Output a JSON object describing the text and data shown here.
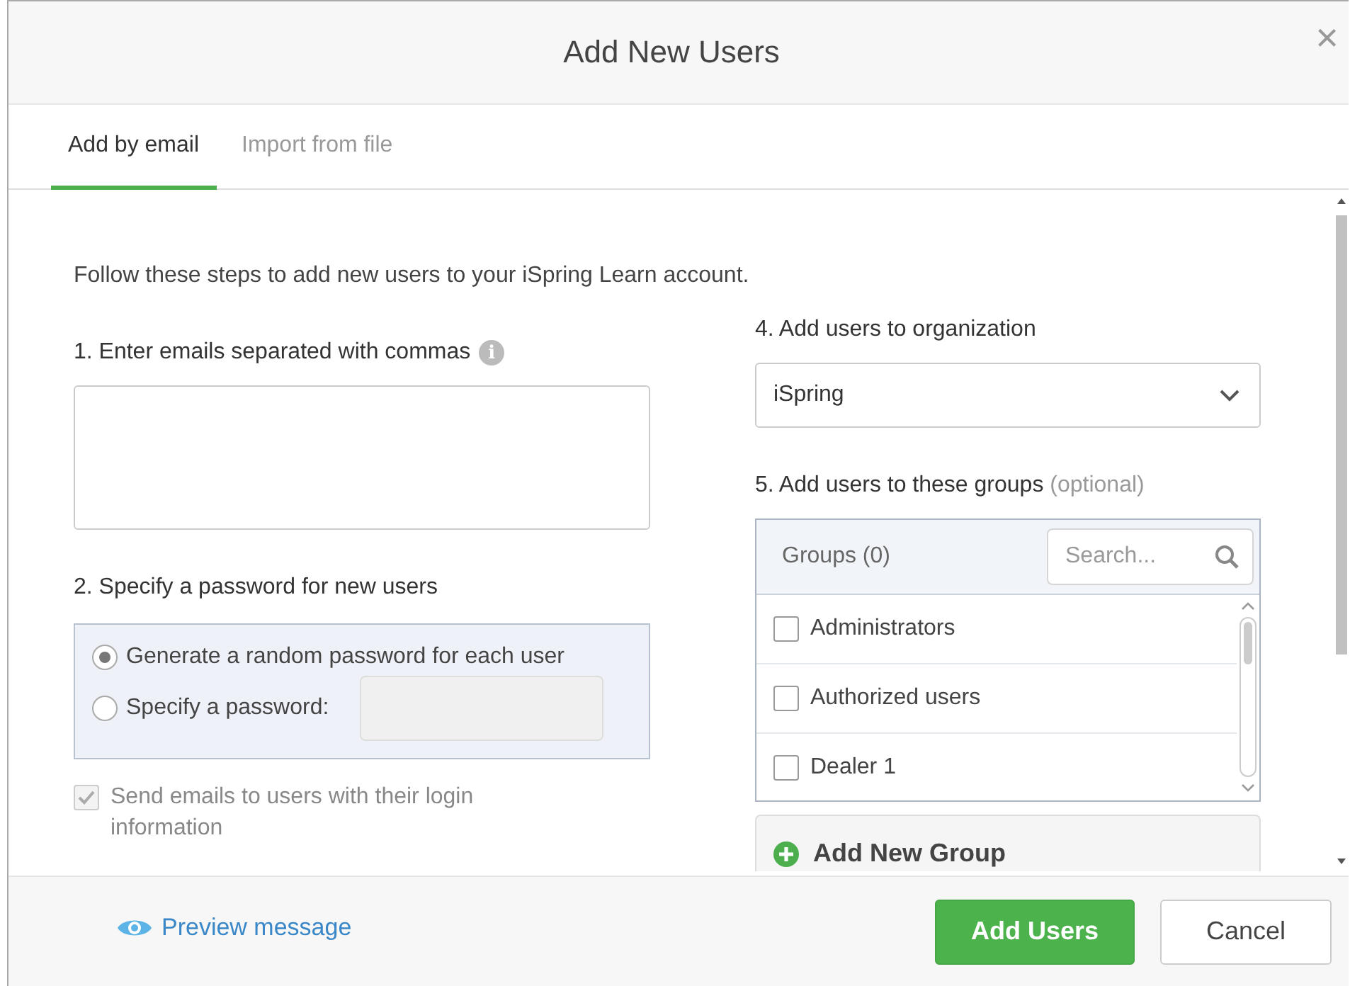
{
  "dialog": {
    "title": "Add New Users",
    "close": "×"
  },
  "tabs": [
    {
      "label": "Add by email",
      "selected": true
    },
    {
      "label": "Import from file",
      "selected": false
    }
  ],
  "intro": "Follow these steps to add new users to your iSpring Learn account.",
  "emails": {
    "label": "1. Enter emails separated with commas",
    "info": "i"
  },
  "password": {
    "label": "2. Specify a password for new users",
    "options": [
      {
        "label": "Generate a random password for each user",
        "selected": true,
        "kind": "plain"
      },
      {
        "label": "Specify a password:",
        "selected": false,
        "kind": "input"
      }
    ]
  },
  "send_emails": {
    "label": "Send emails to users with their login information",
    "checked": true,
    "disabled": true
  },
  "organization": {
    "label": "4. Add users to organization",
    "value": "iSpring"
  },
  "groups": {
    "label": "5. Add users to these groups",
    "optional": "(optional)",
    "header": "Groups (0)",
    "search_placeholder": "Search...",
    "items": [
      {
        "label": "Administrators",
        "checked": false
      },
      {
        "label": "Authorized users",
        "checked": false
      },
      {
        "label": "Dealer 1",
        "checked": false
      }
    ],
    "add_button": "Add New Group"
  },
  "footer": {
    "preview": "Preview message",
    "buttons": [
      {
        "label": "Add Users",
        "kind": "primary"
      },
      {
        "label": "Cancel",
        "kind": "secondary"
      }
    ]
  }
}
